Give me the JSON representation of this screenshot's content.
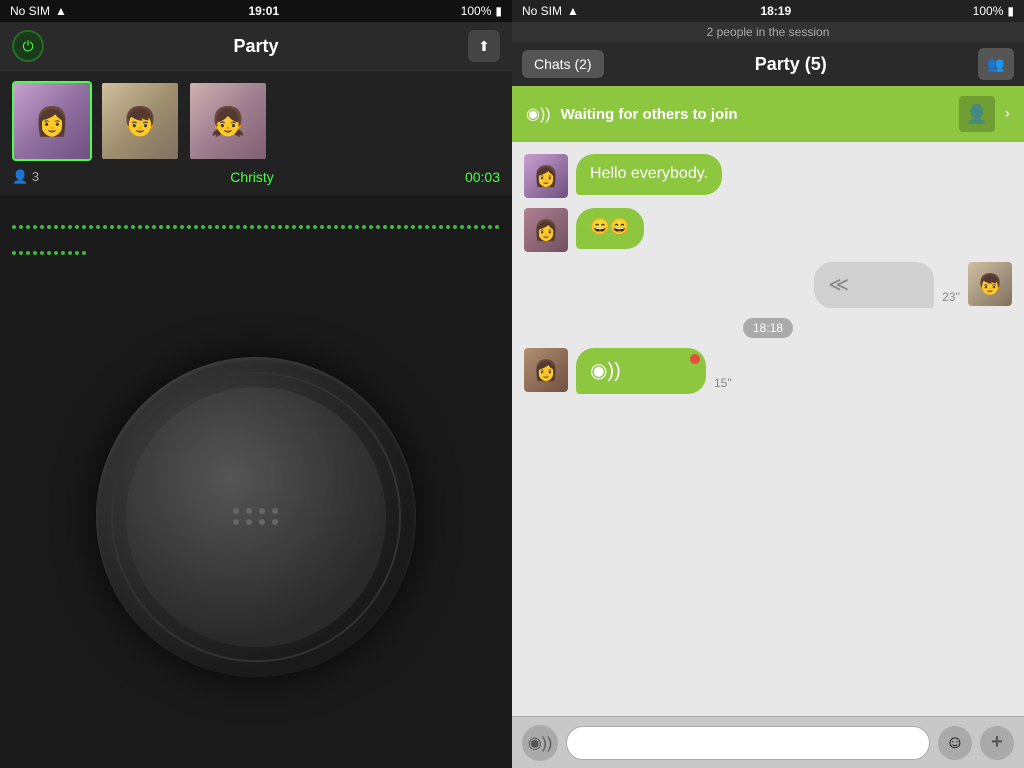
{
  "left": {
    "statusBar": {
      "carrier": "No SIM",
      "wifi": "wifi",
      "time": "19:01",
      "battery": "100%"
    },
    "header": {
      "title": "Party",
      "powerLabel": "⏻",
      "uploadLabel": "⬆"
    },
    "participants": {
      "count": "3",
      "activeUser": "Christy",
      "timer": "00:03",
      "avatars": [
        {
          "id": "av1",
          "emoji": "👩"
        },
        {
          "id": "av2",
          "emoji": "👦"
        },
        {
          "id": "av3",
          "emoji": "👧"
        }
      ]
    },
    "knob": {
      "dots": [
        0,
        1,
        2,
        3,
        4,
        5,
        6,
        7
      ]
    }
  },
  "right": {
    "statusBar": {
      "carrier": "No SIM",
      "wifi": "wifi",
      "time": "18:19",
      "battery": "100%"
    },
    "sessionInfo": "2 people in the session",
    "header": {
      "chatsLabel": "Chats (2)",
      "title": "Party  (5)",
      "peopleIcon": "👥"
    },
    "joinBanner": {
      "text": "Waiting for others to join"
    },
    "messages": [
      {
        "id": "msg1",
        "side": "left",
        "avatar": "cav1",
        "avatarEmoji": "👩",
        "text": "Hello everybody.",
        "type": "text",
        "bubbleColor": "green"
      },
      {
        "id": "msg2",
        "side": "left",
        "avatar": "cav2",
        "avatarEmoji": "👩",
        "text": "😄😄",
        "type": "emoji",
        "bubbleColor": "green"
      },
      {
        "id": "msg3",
        "side": "right",
        "avatar": "cav3",
        "avatarEmoji": "👦",
        "text": "",
        "type": "voice",
        "bubbleColor": "gray",
        "timeLabel": "23''"
      },
      {
        "id": "ts1",
        "type": "timestamp",
        "text": "18:18"
      },
      {
        "id": "msg4",
        "side": "left",
        "avatar": "cav2",
        "avatarEmoji": "👩",
        "text": "",
        "type": "voice",
        "bubbleColor": "green",
        "timeLabel": "15''"
      }
    ],
    "bottomBar": {
      "voiceIcon": "◉",
      "placeholder": "",
      "emojiIcon": "☺",
      "addIcon": "+"
    }
  }
}
